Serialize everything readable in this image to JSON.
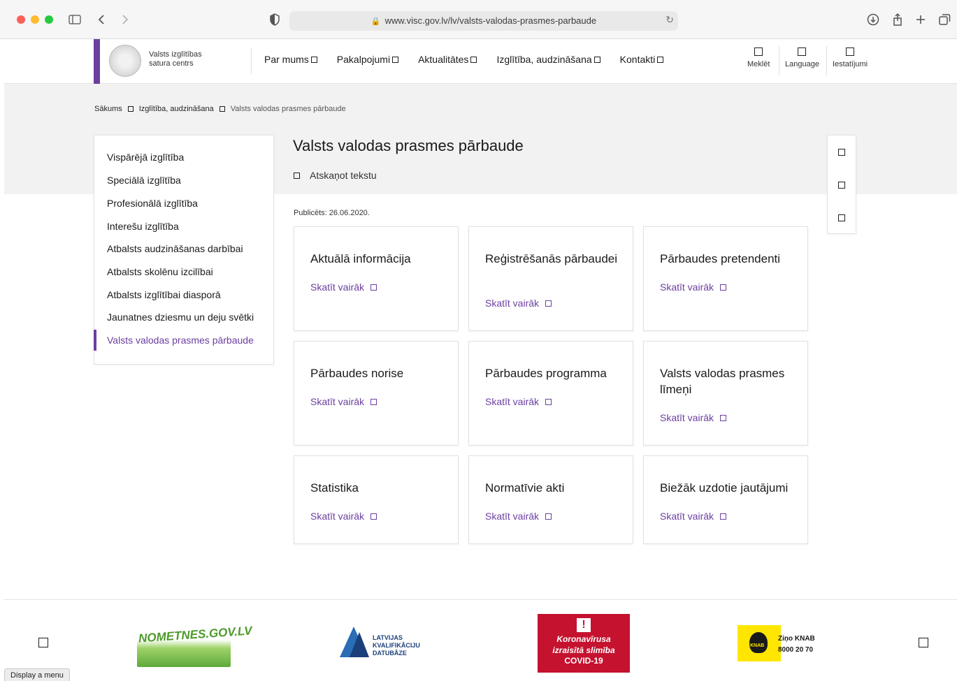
{
  "browser": {
    "url": "www.visc.gov.lv/lv/valsts-valodas-prasmes-parbaude",
    "lock_icon": "lock-icon",
    "reload_icon": "reload-icon"
  },
  "header": {
    "logo_line1": "Valsts izglītības",
    "logo_line2": "satura centrs",
    "nav": [
      "Par mums",
      "Pakalpojumi",
      "Aktualitātes",
      "Izglītība, audzināšana",
      "Kontakti"
    ],
    "utilities": [
      "Meklēt",
      "Language",
      "Iestatījumi"
    ]
  },
  "breadcrumb": [
    "Sākums",
    "Izglītība, audzināšana",
    "Valsts valodas prasmes pārbaude"
  ],
  "sidebar": {
    "items": [
      "Vispārējā izglītība",
      "Speciālā izglītība",
      "Profesionālā izglītība",
      "Interešu izglītība",
      "Atbalsts audzināšanas darbībai",
      "Atbalsts skolēnu izcilībai",
      "Atbalsts izglītībai diasporā",
      "Jaunatnes dziesmu un deju svētki",
      "Valsts valodas prasmes pārbaude"
    ],
    "active_index": 8
  },
  "main": {
    "title": "Valsts valodas prasmes pārbaude",
    "listen_label": "Atskaņot tekstu",
    "published": "Publicēts: 26.06.2020.",
    "link_label": "Skatīt vairāk",
    "cards": [
      "Aktuālā informācija",
      "Reģistrēšanās pārbaudei",
      "Pārbaudes pretendenti",
      "Pārbaudes norise",
      "Pārbaudes programma",
      "Valsts valodas prasmes līmeņi",
      "Statistika",
      "Normatīvie akti",
      "Biežāk uzdotie jautājumi"
    ]
  },
  "footer": {
    "nometnes": "NOMETNES.GOV.LV",
    "lkd_line1": "LATVIJAS",
    "lkd_line2": "KVALIFIKĀCIJU",
    "lkd_line3": "DATUBĀZE",
    "covid_line1": "Koronavīrusa",
    "covid_line2": "izraisītā slimība",
    "covid_line3": "COVID-19",
    "knab_line1": "Ziņo KNAB",
    "knab_line2": "8000 20 70",
    "knab_badge": "KNAB"
  },
  "status_tip": "Display a menu"
}
